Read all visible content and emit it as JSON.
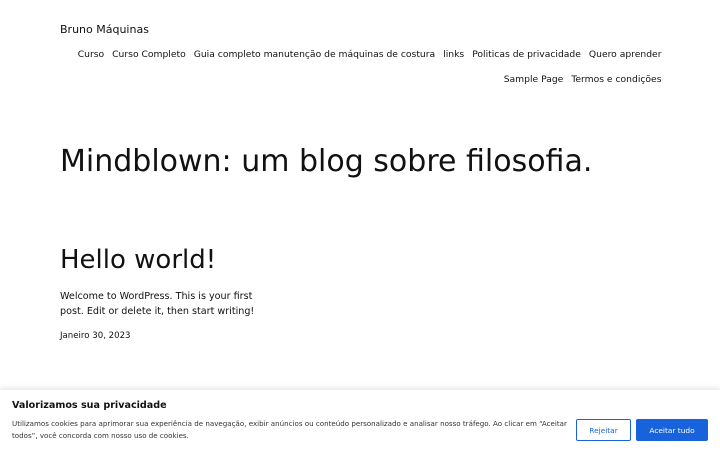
{
  "site": {
    "title": "Bruno Máquinas"
  },
  "nav": {
    "items": [
      "Curso",
      "Curso Completo",
      "Guia completo manutenção de máquinas de costura",
      "links",
      "Politicas de privacidade",
      "Quero aprender",
      "Sample Page",
      "Termos e condições"
    ]
  },
  "blog": {
    "heading": "Mindblown: um blog sobre filosofia."
  },
  "post": {
    "title": "Hello world!",
    "excerpt": "Welcome to WordPress. This is your first post. Edit or delete it, then start writing!",
    "date": "Janeiro 30, 2023"
  },
  "cookie": {
    "title": "Valorizamos sua privacidade",
    "text": "Utilizamos cookies para aprimorar sua experiência de navegação, exibir anúncios ou conteúdo personalizado e analisar nosso tráfego. Ao clicar em “Aceitar todos”, você concorda com nosso uso de cookies.",
    "reject_label": "Rejeitar",
    "accept_label": "Aceitar tudo"
  },
  "colors": {
    "accent": "#1863dc",
    "text": "#111111"
  }
}
